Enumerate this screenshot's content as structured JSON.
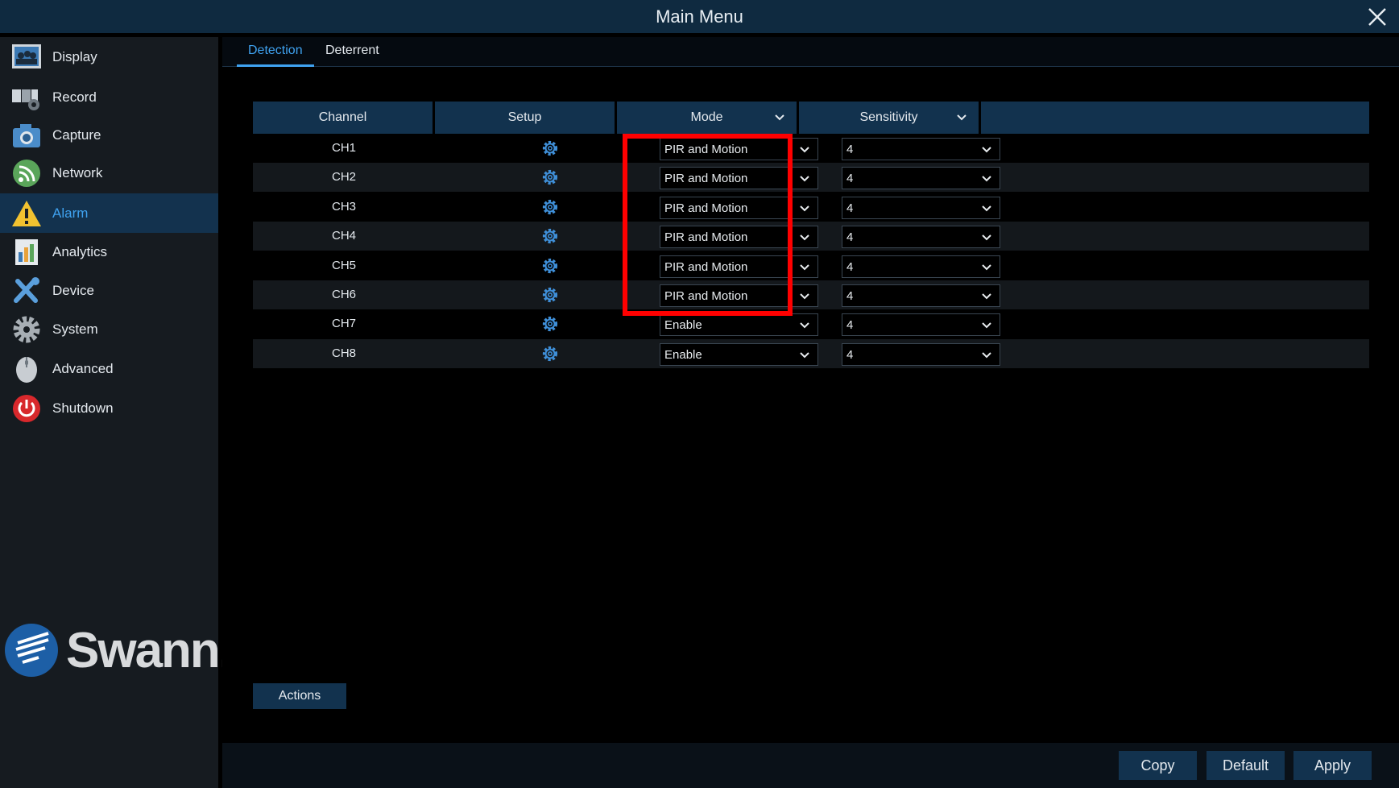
{
  "window": {
    "title": "Main Menu"
  },
  "sidebar": {
    "items": [
      {
        "label": "Display",
        "icon": "display-icon"
      },
      {
        "label": "Record",
        "icon": "record-icon"
      },
      {
        "label": "Capture",
        "icon": "camera-icon"
      },
      {
        "label": "Network",
        "icon": "network-icon"
      },
      {
        "label": "Alarm",
        "icon": "warning-icon",
        "active": true
      },
      {
        "label": "Analytics",
        "icon": "analytics-icon"
      },
      {
        "label": "Device",
        "icon": "tools-icon"
      },
      {
        "label": "System",
        "icon": "gear-icon"
      },
      {
        "label": "Advanced",
        "icon": "mouse-icon"
      },
      {
        "label": "Shutdown",
        "icon": "power-icon"
      }
    ],
    "logo_text": "Swann."
  },
  "tabs": [
    {
      "label": "Detection",
      "active": true
    },
    {
      "label": "Deterrent",
      "active": false
    }
  ],
  "table": {
    "headers": {
      "channel": "Channel",
      "setup": "Setup",
      "mode": "Mode",
      "sensitivity": "Sensitivity"
    },
    "rows": [
      {
        "channel": "CH1",
        "mode": "PIR and Motion",
        "sensitivity": "4"
      },
      {
        "channel": "CH2",
        "mode": "PIR and Motion",
        "sensitivity": "4"
      },
      {
        "channel": "CH3",
        "mode": "PIR and Motion",
        "sensitivity": "4"
      },
      {
        "channel": "CH4",
        "mode": "PIR and Motion",
        "sensitivity": "4"
      },
      {
        "channel": "CH5",
        "mode": "PIR and Motion",
        "sensitivity": "4"
      },
      {
        "channel": "CH6",
        "mode": "PIR and Motion",
        "sensitivity": "4"
      },
      {
        "channel": "CH7",
        "mode": "Enable",
        "sensitivity": "4"
      },
      {
        "channel": "CH8",
        "mode": "Enable",
        "sensitivity": "4"
      }
    ]
  },
  "buttons": {
    "actions": "Actions",
    "copy": "Copy",
    "default": "Default",
    "apply": "Apply"
  },
  "colors": {
    "accent": "#3fa2f0",
    "header_bg": "#12324e",
    "highlight": "#ff0000"
  }
}
